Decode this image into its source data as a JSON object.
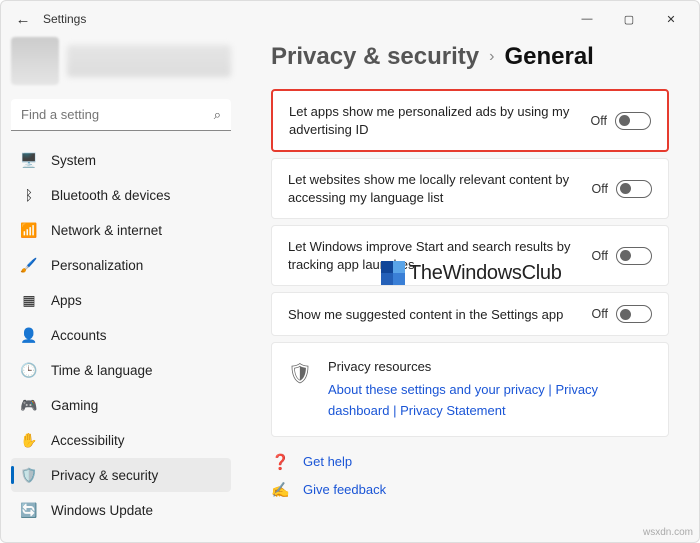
{
  "window": {
    "title": "Settings"
  },
  "search": {
    "placeholder": "Find a setting"
  },
  "nav": [
    {
      "icon": "🖥️",
      "label": "System"
    },
    {
      "icon": "ᛒ",
      "label": "Bluetooth & devices"
    },
    {
      "icon": "📶",
      "label": "Network & internet"
    },
    {
      "icon": "🖌️",
      "label": "Personalization"
    },
    {
      "icon": "▦",
      "label": "Apps"
    },
    {
      "icon": "👤",
      "label": "Accounts"
    },
    {
      "icon": "🕒",
      "label": "Time & language"
    },
    {
      "icon": "🎮",
      "label": "Gaming"
    },
    {
      "icon": "✋",
      "label": "Accessibility"
    },
    {
      "icon": "🛡️",
      "label": "Privacy & security"
    },
    {
      "icon": "🔄",
      "label": "Windows Update"
    }
  ],
  "breadcrumb": {
    "parent": "Privacy & security",
    "current": "General"
  },
  "settings": [
    {
      "text": "Let apps show me personalized ads by using my advertising ID",
      "state": "Off",
      "highlight": true
    },
    {
      "text": "Let websites show me locally relevant content by accessing my language list",
      "state": "Off",
      "highlight": false
    },
    {
      "text": "Let Windows improve Start and search results by tracking app launches",
      "state": "Off",
      "highlight": false
    },
    {
      "text": "Show me suggested content in the Settings app",
      "state": "Off",
      "highlight": false
    }
  ],
  "resources": {
    "heading": "Privacy resources",
    "links": [
      "About these settings and your privacy",
      "Privacy dashboard",
      "Privacy Statement"
    ]
  },
  "footer": {
    "help": "Get help",
    "feedback": "Give feedback"
  },
  "watermark": "TheWindowsClub",
  "source": "wsxdn.com"
}
